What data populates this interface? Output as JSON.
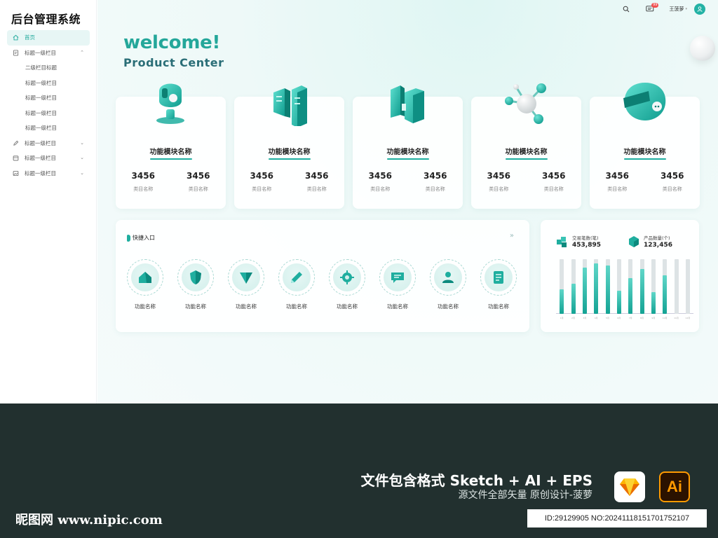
{
  "app_title": "后台管理系统",
  "sidebar": {
    "items": [
      {
        "label": "首页",
        "icon": "home-icon",
        "active": true
      },
      {
        "label": "标题一级栏目",
        "icon": "document-icon",
        "chevron": "⌃"
      },
      {
        "label": "二级栏目标题",
        "sub": true
      },
      {
        "label": "标题一级栏目",
        "sub": true
      },
      {
        "label": "标题一级栏目",
        "sub": true
      },
      {
        "label": "标题一级栏目",
        "sub": true
      },
      {
        "label": "标题一级栏目",
        "sub": true
      },
      {
        "label": "标题一级栏目",
        "icon": "pencil-icon",
        "chevron": "⌄"
      },
      {
        "label": "标题一级栏目",
        "icon": "calendar-icon",
        "chevron": "⌄"
      },
      {
        "label": "标题一级栏目",
        "icon": "image-icon",
        "chevron": "⌄"
      }
    ]
  },
  "topbar": {
    "message_badge": "99",
    "username": "王菠萝",
    "user_caret": "▾"
  },
  "hero": {
    "welcome": "welcome!",
    "subtitle": "Product Center"
  },
  "cards": [
    {
      "title": "功能模块名称",
      "icon": "robot-head-icon",
      "stats": [
        {
          "value": "3456",
          "label": "类目名称"
        },
        {
          "value": "3456",
          "label": "类目名称"
        }
      ]
    },
    {
      "title": "功能模块名称",
      "icon": "buildings-icon",
      "stats": [
        {
          "value": "3456",
          "label": "类目名称"
        },
        {
          "value": "3456",
          "label": "类目名称"
        }
      ]
    },
    {
      "title": "功能模块名称",
      "icon": "door-panels-icon",
      "stats": [
        {
          "value": "3456",
          "label": "类目名称"
        },
        {
          "value": "3456",
          "label": "类目名称"
        }
      ]
    },
    {
      "title": "功能模块名称",
      "icon": "molecule-network-icon",
      "stats": [
        {
          "value": "3456",
          "label": "类目名称"
        },
        {
          "value": "3456",
          "label": "类目名称"
        }
      ]
    },
    {
      "title": "功能模块名称",
      "icon": "chat-bubble-icon",
      "stats": [
        {
          "value": "3456",
          "label": "类目名称"
        },
        {
          "value": "3456",
          "label": "类目名称"
        }
      ]
    }
  ],
  "quick": {
    "title": "快捷入口",
    "more": "»",
    "items": [
      {
        "label": "功能名称",
        "icon": "home-3d-icon"
      },
      {
        "label": "功能名称",
        "icon": "shield-icon"
      },
      {
        "label": "功能名称",
        "icon": "triangle-down-icon"
      },
      {
        "label": "功能名称",
        "icon": "pencil-3d-icon"
      },
      {
        "label": "功能名称",
        "icon": "gear-icon"
      },
      {
        "label": "功能名称",
        "icon": "message-icon"
      },
      {
        "label": "功能名称",
        "icon": "user-icon"
      },
      {
        "label": "功能名称",
        "icon": "document-3d-icon"
      }
    ]
  },
  "stats": {
    "trade": {
      "label": "交易笔数(笔)",
      "value": "453,895",
      "icon": "cubes-icon"
    },
    "product": {
      "label": "产品数量(个)",
      "value": "123,456",
      "icon": "cube-icon"
    }
  },
  "chart_data": {
    "type": "bar",
    "categories": [
      "1月",
      "2月",
      "3月",
      "4月",
      "5月",
      "6月",
      "7月",
      "8月",
      "9月",
      "10月",
      "11月",
      "12月"
    ],
    "series": [
      {
        "values": [
          0.45,
          0.55,
          0.85,
          0.92,
          0.88,
          0.42,
          0.65,
          0.82,
          0.4,
          0.7,
          0,
          0
        ]
      },
      {
        "values": [
          1,
          1,
          1,
          1,
          1,
          1,
          1,
          1,
          1,
          1,
          1,
          1
        ]
      }
    ],
    "ylim": [
      0,
      1
    ]
  },
  "footer": {
    "main": "文件包含格式 Sketch + AI + EPS",
    "sub": "源文件全部矢量 原创设计-菠萝",
    "logo": "昵图网 www.nipic.com",
    "id_text": "ID:29129905 NO:20241118151701752107",
    "ai_label": "Ai"
  },
  "colors": {
    "accent": "#1fae9f",
    "footer_bg": "#22302f"
  }
}
